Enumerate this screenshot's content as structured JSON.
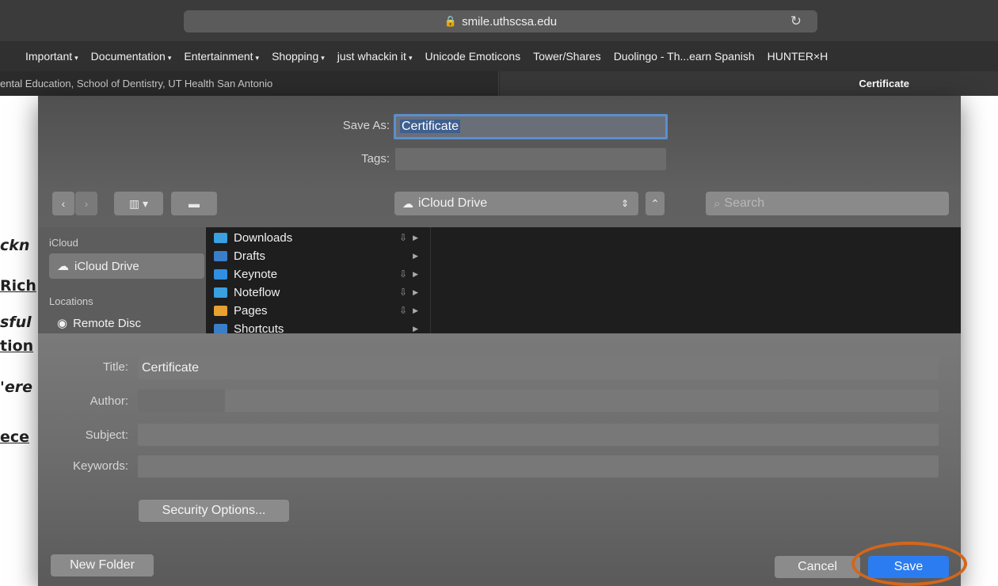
{
  "browser": {
    "url": "smile.uthscsa.edu",
    "bookmarks": [
      {
        "label": "Important",
        "menu": true
      },
      {
        "label": "Documentation",
        "menu": true
      },
      {
        "label": "Entertainment",
        "menu": true
      },
      {
        "label": "Shopping",
        "menu": true
      },
      {
        "label": "just whackin it",
        "menu": true
      },
      {
        "label": "Unicode Emoticons",
        "menu": false
      },
      {
        "label": "Tower/Shares",
        "menu": false
      },
      {
        "label": "Duolingo - Th...earn Spanish",
        "menu": false
      },
      {
        "label": "HUNTER×H",
        "menu": false
      }
    ],
    "tabs": [
      {
        "label": "ental Education, School of Dentistry, UT Health San Antonio"
      },
      {
        "label": "Certificate"
      }
    ]
  },
  "page_fragments": [
    "ckn",
    "Rich",
    "sful",
    "tion",
    "'ere",
    "ece"
  ],
  "dialog": {
    "save_as_label": "Save As:",
    "save_as_value": "Certificate",
    "tags_label": "Tags:",
    "location": "iCloud Drive",
    "search_placeholder": "Search",
    "sidebar": {
      "icloud_header": "iCloud",
      "icloud_drive": "iCloud Drive",
      "locations_header": "Locations",
      "remote_disc": "Remote Disc"
    },
    "files": [
      {
        "name": "Downloads",
        "color": "#3aa0e0",
        "cloud": true
      },
      {
        "name": "Drafts",
        "color": "#3a7ec8",
        "cloud": false
      },
      {
        "name": "Keynote",
        "color": "#2f8fe0",
        "cloud": true
      },
      {
        "name": "Noteflow",
        "color": "#3aa0e0",
        "cloud": true
      },
      {
        "name": "Pages",
        "color": "#e8a030",
        "cloud": true
      },
      {
        "name": "Shortcuts",
        "color": "#3a7ec8",
        "cloud": false
      }
    ],
    "metadata": {
      "title_label": "Title:",
      "title_value": "Certificate",
      "author_label": "Author:",
      "author_value": "",
      "subject_label": "Subject:",
      "subject_value": "",
      "keywords_label": "Keywords:",
      "keywords_value": ""
    },
    "security_button": "Security Options...",
    "new_folder_button": "New Folder",
    "cancel_button": "Cancel",
    "save_button": "Save"
  }
}
